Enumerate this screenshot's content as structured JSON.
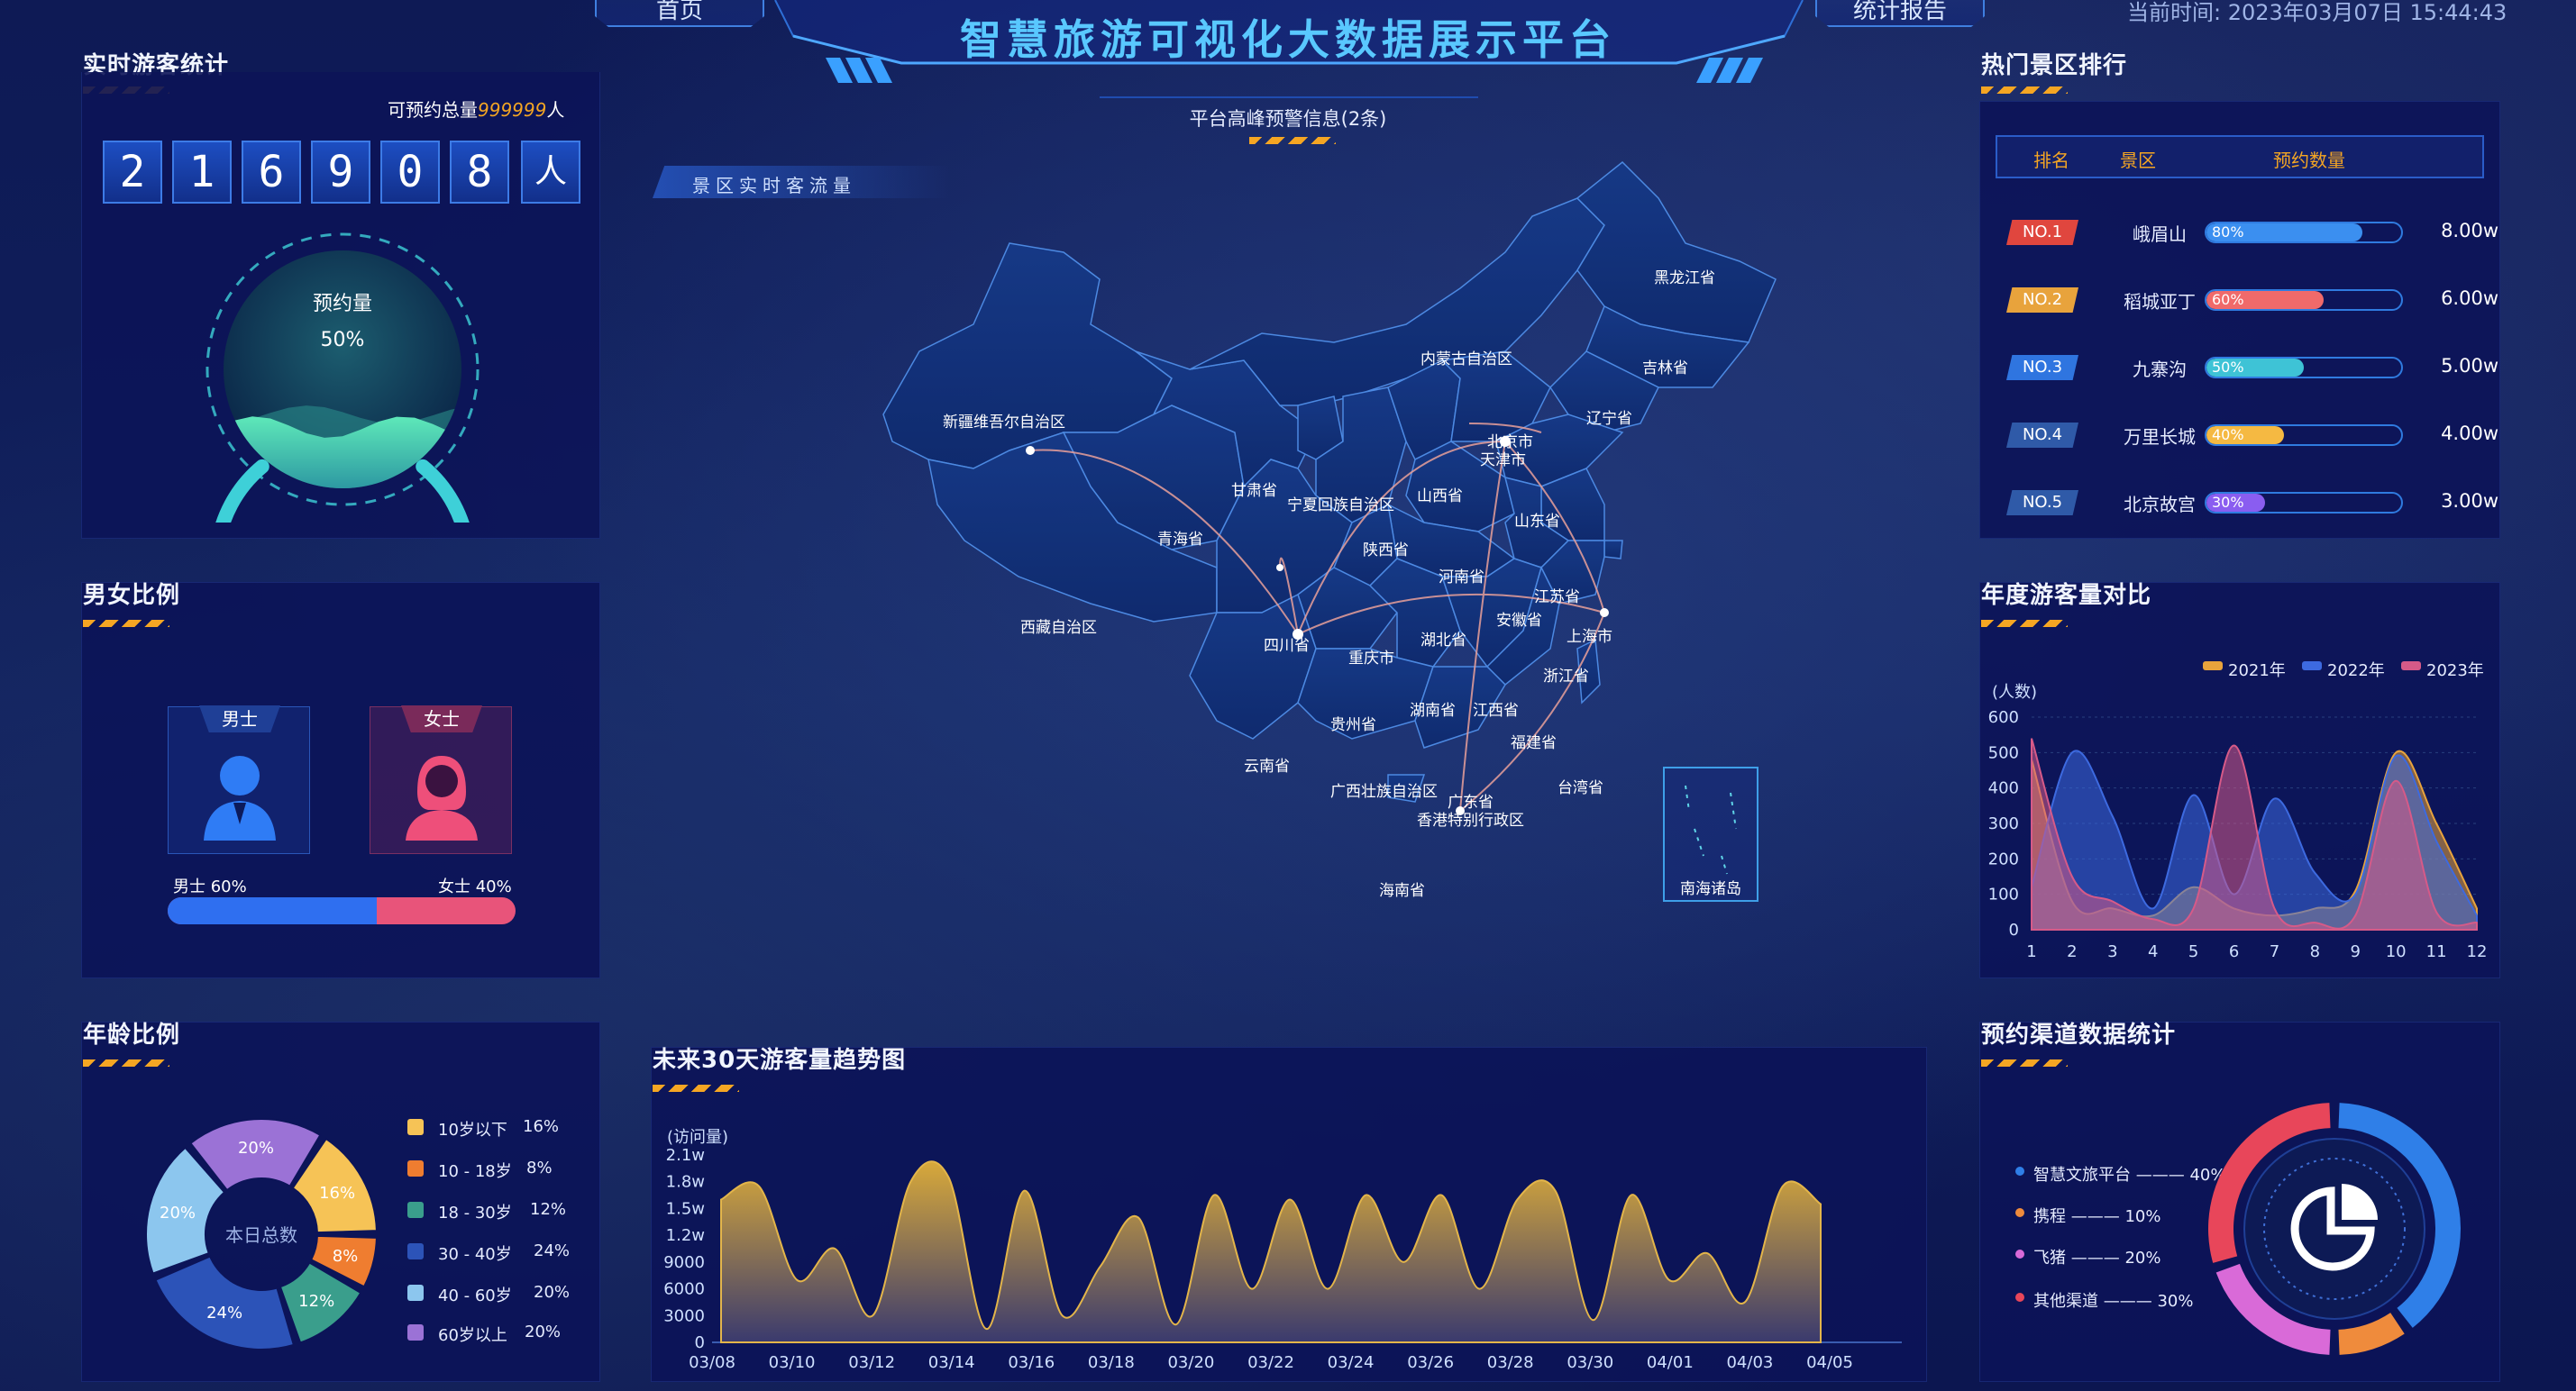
{
  "header": {
    "title": "智慧旅游可视化大数据展示平台",
    "nav_left": "首页",
    "nav_right": "统计报告",
    "time_label": "当前时间:",
    "time_value": "2023年03月07日 15:44:43",
    "alert_text": "平台高峰预警信息(2条)"
  },
  "visitors": {
    "title": "实时游客统计",
    "total_label": "可预约总量",
    "total_value": "999999",
    "total_unit": "人",
    "digits": [
      "2",
      "1",
      "6",
      "9",
      "0",
      "8"
    ],
    "digit_unit": "人",
    "gauge_label": "预约量",
    "gauge_percent": "50%",
    "gauge_fraction": 0.5
  },
  "gender": {
    "title": "男女比例",
    "male_label": "男士",
    "female_label": "女士",
    "male_stat": "男士 60%",
    "female_stat": "女士 40%",
    "male_fraction": 0.6,
    "colors": {
      "male": "#2f6ff0",
      "female": "#e8547a"
    }
  },
  "age": {
    "title": "年龄比例",
    "center_label": "本日总数",
    "items": [
      {
        "label": "10岁以下",
        "value": "16%",
        "pct": 16,
        "color": "#f6c356"
      },
      {
        "label": "10 - 18岁",
        "value": "8%",
        "pct": 8,
        "color": "#ef7d30"
      },
      {
        "label": "18 - 30岁",
        "value": "12%",
        "pct": 12,
        "color": "#3a9e8c"
      },
      {
        "label": "30 - 40岁",
        "value": "24%",
        "pct": 24,
        "color": "#2c53b8"
      },
      {
        "label": "40 - 60岁",
        "value": "20%",
        "pct": 20,
        "color": "#8cc6ee"
      },
      {
        "label": "60岁以上",
        "value": "20%",
        "pct": 20,
        "color": "#9b72d6"
      }
    ]
  },
  "map": {
    "section_label": "景区实时客流量",
    "provinces": [
      "黑龙江省",
      "吉林省",
      "辽宁省",
      "内蒙古自治区",
      "新疆维吾尔自治区",
      "甘肃省",
      "宁夏回族自治区",
      "山西省",
      "北京市",
      "天津市",
      "山东省",
      "青海省",
      "陕西省",
      "河南省",
      "江苏省",
      "安徽省",
      "上海市",
      "西藏自治区",
      "四川省",
      "重庆市",
      "湖北省",
      "浙江省",
      "湖南省",
      "江西省",
      "贵州省",
      "福建省",
      "云南省",
      "广西壮族自治区",
      "广东省",
      "台湾省",
      "海南省",
      "香港特别行政区",
      "南海诸岛"
    ]
  },
  "ranking": {
    "title": "热门景区排行",
    "headers": [
      "排名",
      "景区",
      "预约数量"
    ],
    "rows": [
      {
        "rank": "NO.1",
        "name": "峨眉山",
        "percent": "80%",
        "fraction": 0.8,
        "value": "8.00w",
        "badge": "#e0463e",
        "bar": "#3b8ff0"
      },
      {
        "rank": "NO.2",
        "name": "稻城亚丁",
        "percent": "60%",
        "fraction": 0.6,
        "value": "6.00w",
        "badge": "#e8a33c",
        "bar": "#f06a6a"
      },
      {
        "rank": "NO.3",
        "name": "九寨沟",
        "percent": "50%",
        "fraction": 0.5,
        "value": "5.00w",
        "badge": "#2f75e0",
        "bar": "#3ec3d6"
      },
      {
        "rank": "NO.4",
        "name": "万里长城",
        "percent": "40%",
        "fraction": 0.4,
        "value": "4.00w",
        "badge": "#2f5aa8",
        "bar": "#f5b942"
      },
      {
        "rank": "NO.5",
        "name": "北京故宫",
        "percent": "30%",
        "fraction": 0.3,
        "value": "3.00w",
        "badge": "#2f5aa8",
        "bar": "#8a5df0"
      }
    ]
  },
  "yearly": {
    "title": "年度游客量对比",
    "unit_label": "(人数)",
    "chart_data": {
      "type": "area",
      "x": [
        1,
        2,
        3,
        4,
        5,
        6,
        7,
        8,
        9,
        10,
        11,
        12
      ],
      "ylim": [
        0,
        600
      ],
      "yticks": [
        0,
        100,
        200,
        300,
        400,
        500,
        600
      ],
      "series": [
        {
          "name": "2021年",
          "color": "#e8a33c",
          "values": [
            480,
            80,
            60,
            40,
            120,
            60,
            40,
            60,
            110,
            500,
            300,
            60
          ]
        },
        {
          "name": "2022年",
          "color": "#3d6ae0",
          "values": [
            120,
            500,
            320,
            60,
            380,
            100,
            370,
            160,
            100,
            490,
            250,
            40
          ]
        },
        {
          "name": "2023年",
          "color": "#d65a88",
          "values": [
            540,
            150,
            80,
            30,
            60,
            520,
            60,
            20,
            40,
            420,
            50,
            20
          ]
        }
      ]
    }
  },
  "trend": {
    "title": "未来30天游客量趋势图",
    "unit_label": "(访问量)",
    "chart_data": {
      "type": "area",
      "categories": [
        "03/08",
        "03/10",
        "03/12",
        "03/14",
        "03/16",
        "03/18",
        "03/20",
        "03/22",
        "03/24",
        "03/26",
        "03/28",
        "03/30",
        "04/01",
        "04/03",
        "04/05"
      ],
      "ytick_labels": [
        "0",
        "3000",
        "6000",
        "9000",
        "1.2w",
        "1.5w",
        "1.8w",
        "2.1w"
      ],
      "ylim": [
        0,
        21000
      ],
      "values": [
        16000,
        17500,
        7000,
        10500,
        3000,
        18000,
        18500,
        1500,
        17000,
        3000,
        8500,
        14000,
        2000,
        16500,
        6000,
        16000,
        6000,
        16500,
        9000,
        16500,
        6000,
        16000,
        17000,
        2500,
        16500,
        7000,
        10000,
        4500,
        17500,
        15500
      ]
    }
  },
  "channels": {
    "title": "预约渠道数据统计",
    "items": [
      {
        "label": "智慧文旅平台 ——— 40%",
        "pct": 40,
        "color": "#2f7fe8"
      },
      {
        "label": "携程 ——— 10%",
        "pct": 10,
        "color": "#ef8b3c"
      },
      {
        "label": "飞猪 ——— 20%",
        "pct": 20,
        "color": "#d96ad8"
      },
      {
        "label": "其他渠道 ——— 30%",
        "pct": 30,
        "color": "#e8465a"
      }
    ]
  }
}
